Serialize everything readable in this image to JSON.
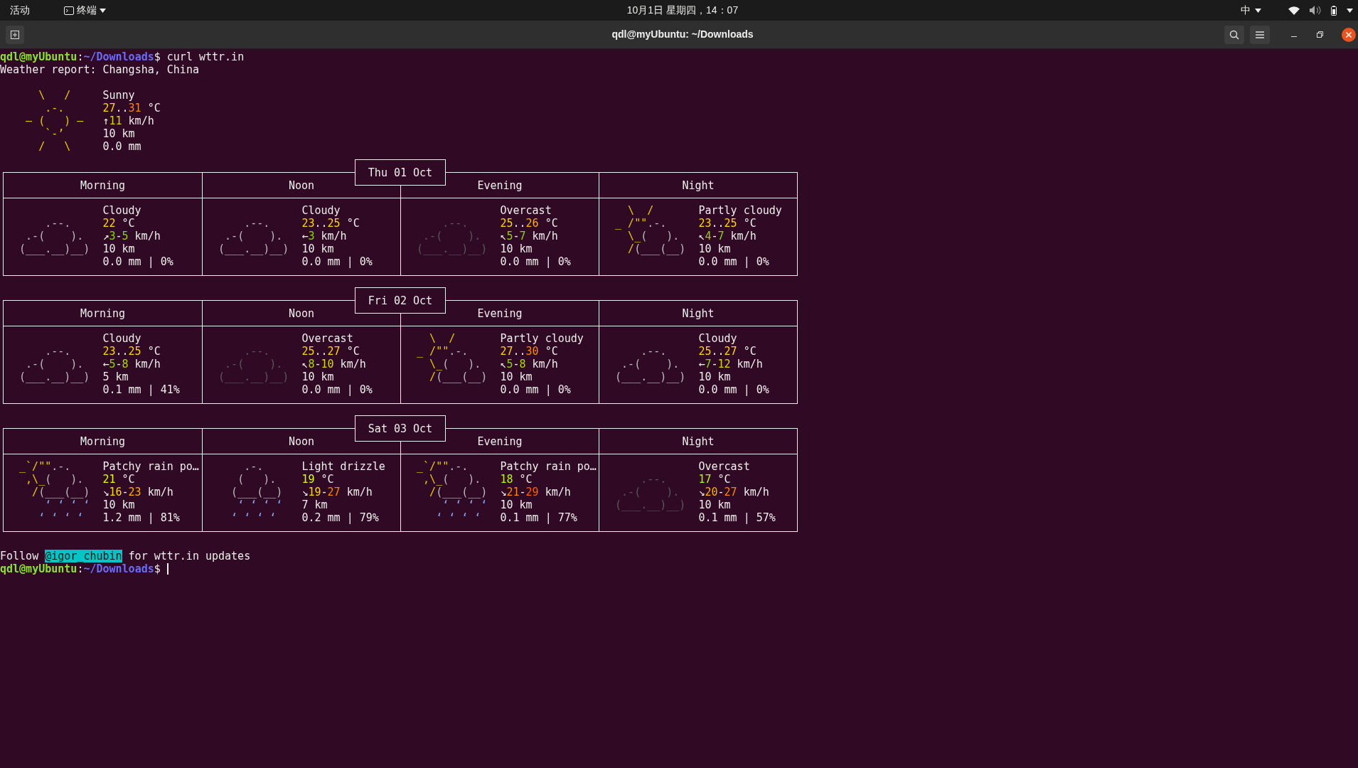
{
  "top_bar": {
    "activities": "活动",
    "app_menu": "终端",
    "clock": "10月1日 星期四，14：07",
    "input_method": "中"
  },
  "window": {
    "title": "qdl@myUbuntu: ~/Downloads"
  },
  "terminal": {
    "prompt": {
      "user_host": "qdl@myUbuntu",
      "separator": ":",
      "path": "~/Downloads",
      "symbol": "$",
      "command": " curl wttr.in"
    },
    "report_line": "Weather report: Changsha, China",
    "current": {
      "kind": "sunny",
      "art": [
        [
          {
            "text": "    \\   /",
            "color": "#e6c800"
          }
        ],
        [
          {
            "text": "     .-.",
            "color": "#e6c800"
          }
        ],
        [
          {
            "text": "  ― (   ) ―",
            "color": "#e6c800"
          }
        ],
        [
          {
            "text": "     `-’",
            "color": "#e6c800"
          }
        ],
        [
          {
            "text": "    /   \\",
            "color": "#e6c800"
          }
        ]
      ],
      "lines": [
        [
          {
            "text": "Sunny"
          }
        ],
        [
          {
            "text": "27",
            "color": "#ffd700"
          },
          {
            "text": ".."
          },
          {
            "text": "31",
            "color": "#ff8700"
          },
          {
            "text": " °C"
          }
        ],
        [
          {
            "text": "↑"
          },
          {
            "text": "11",
            "color": "#d7d700"
          },
          {
            "text": " km/h"
          }
        ],
        [
          {
            "text": "10 km"
          }
        ],
        [
          {
            "text": "0.0 mm"
          }
        ]
      ]
    },
    "days": [
      {
        "date": "Thu 01 Oct",
        "periods": [
          {
            "label": "Morning",
            "kind": "cloudy",
            "art": [
              [
                {
                  "text": "     .--.",
                  "color": "#bcbcbc"
                }
              ],
              [
                {
                  "text": "  .-(    ).",
                  "color": "#bcbcbc"
                }
              ],
              [
                {
                  "text": " (___.__)__)",
                  "color": "#bcbcbc"
                }
              ]
            ],
            "lines": [
              [
                {
                  "text": "Cloudy"
                }
              ],
              [
                {
                  "text": "22",
                  "color": "#ffd700"
                },
                {
                  "text": " °C"
                }
              ],
              [
                {
                  "text": "↗"
                },
                {
                  "text": "3",
                  "color": "#87d700"
                },
                {
                  "text": "-"
                },
                {
                  "text": "5",
                  "color": "#87d700"
                },
                {
                  "text": " km/h"
                }
              ],
              [
                {
                  "text": "10 km"
                }
              ],
              [
                {
                  "text": "0.0 mm | 0%"
                }
              ]
            ]
          },
          {
            "label": "Noon",
            "kind": "cloudy",
            "art": [
              [
                {
                  "text": "     .--.",
                  "color": "#bcbcbc"
                }
              ],
              [
                {
                  "text": "  .-(    ).",
                  "color": "#bcbcbc"
                }
              ],
              [
                {
                  "text": " (___.__)__)",
                  "color": "#bcbcbc"
                }
              ]
            ],
            "lines": [
              [
                {
                  "text": "Cloudy"
                }
              ],
              [
                {
                  "text": "23",
                  "color": "#ffd700"
                },
                {
                  "text": ".."
                },
                {
                  "text": "25",
                  "color": "#ffd700"
                },
                {
                  "text": " °C"
                }
              ],
              [
                {
                  "text": "←"
                },
                {
                  "text": "3",
                  "color": "#87d700"
                },
                {
                  "text": " km/h"
                }
              ],
              [
                {
                  "text": "10 km"
                }
              ],
              [
                {
                  "text": "0.0 mm | 0%"
                }
              ]
            ]
          },
          {
            "label": "Evening",
            "kind": "overcast",
            "art": [
              [
                {
                  "text": "     .--.",
                  "color": "#585858"
                }
              ],
              [
                {
                  "text": "  .-(    ).",
                  "color": "#585858"
                }
              ],
              [
                {
                  "text": " (___.__)__)",
                  "color": "#585858"
                }
              ]
            ],
            "lines": [
              [
                {
                  "text": "Overcast"
                }
              ],
              [
                {
                  "text": "25",
                  "color": "#ffd700"
                },
                {
                  "text": ".."
                },
                {
                  "text": "26",
                  "color": "#ffaf00"
                },
                {
                  "text": " °C"
                }
              ],
              [
                {
                  "text": "↖"
                },
                {
                  "text": "5",
                  "color": "#87d700"
                },
                {
                  "text": "-"
                },
                {
                  "text": "7",
                  "color": "#87d700"
                },
                {
                  "text": " km/h"
                }
              ],
              [
                {
                  "text": "10 km"
                }
              ],
              [
                {
                  "text": "0.0 mm | 0%"
                }
              ]
            ]
          },
          {
            "label": "Night",
            "kind": "partly_cloudy",
            "art": [
              [
                {
                  "text": "   \\  /",
                  "color": "#e6c800"
                }
              ],
              [
                {
                  "text": " _ /\"\"",
                  "color": "#e6c800"
                },
                {
                  "text": ".-.",
                  "color": "#bcbcbc"
                }
              ],
              [
                {
                  "text": "   \\_",
                  "color": "#e6c800"
                },
                {
                  "text": "(   ).",
                  "color": "#bcbcbc"
                }
              ],
              [
                {
                  "text": "   /",
                  "color": "#e6c800"
                },
                {
                  "text": "(___(__)",
                  "color": "#bcbcbc"
                }
              ]
            ],
            "lines": [
              [
                {
                  "text": "Partly cloudy"
                }
              ],
              [
                {
                  "text": "23",
                  "color": "#ffd700"
                },
                {
                  "text": ".."
                },
                {
                  "text": "25",
                  "color": "#ffd700"
                },
                {
                  "text": " °C"
                }
              ],
              [
                {
                  "text": "↖"
                },
                {
                  "text": "4",
                  "color": "#87d700"
                },
                {
                  "text": "-"
                },
                {
                  "text": "7",
                  "color": "#87d700"
                },
                {
                  "text": " km/h"
                }
              ],
              [
                {
                  "text": "10 km"
                }
              ],
              [
                {
                  "text": "0.0 mm | 0%"
                }
              ]
            ]
          }
        ]
      },
      {
        "date": "Fri 02 Oct",
        "periods": [
          {
            "label": "Morning",
            "kind": "cloudy",
            "art": [
              [
                {
                  "text": "     .--.",
                  "color": "#bcbcbc"
                }
              ],
              [
                {
                  "text": "  .-(    ).",
                  "color": "#bcbcbc"
                }
              ],
              [
                {
                  "text": " (___.__)__)",
                  "color": "#bcbcbc"
                }
              ]
            ],
            "lines": [
              [
                {
                  "text": "Cloudy"
                }
              ],
              [
                {
                  "text": "23",
                  "color": "#ffd700"
                },
                {
                  "text": ".."
                },
                {
                  "text": "25",
                  "color": "#ffd700"
                },
                {
                  "text": " °C"
                }
              ],
              [
                {
                  "text": "←"
                },
                {
                  "text": "5",
                  "color": "#87d700"
                },
                {
                  "text": "-"
                },
                {
                  "text": "8",
                  "color": "#afd700"
                },
                {
                  "text": " km/h"
                }
              ],
              [
                {
                  "text": "5 km"
                }
              ],
              [
                {
                  "text": "0.1 mm | 41%"
                }
              ]
            ]
          },
          {
            "label": "Noon",
            "kind": "overcast",
            "art": [
              [
                {
                  "text": "     .--.",
                  "color": "#585858"
                }
              ],
              [
                {
                  "text": "  .-(    ).",
                  "color": "#585858"
                }
              ],
              [
                {
                  "text": " (___.__)__)",
                  "color": "#585858"
                }
              ]
            ],
            "lines": [
              [
                {
                  "text": "Overcast"
                }
              ],
              [
                {
                  "text": "25",
                  "color": "#ffd700"
                },
                {
                  "text": ".."
                },
                {
                  "text": "27",
                  "color": "#ffd700"
                },
                {
                  "text": " °C"
                }
              ],
              [
                {
                  "text": "↖"
                },
                {
                  "text": "8",
                  "color": "#afd700"
                },
                {
                  "text": "-"
                },
                {
                  "text": "10",
                  "color": "#d7d700"
                },
                {
                  "text": " km/h"
                }
              ],
              [
                {
                  "text": "10 km"
                }
              ],
              [
                {
                  "text": "0.0 mm | 0%"
                }
              ]
            ]
          },
          {
            "label": "Evening",
            "kind": "partly_cloudy",
            "art": [
              [
                {
                  "text": "   \\  /",
                  "color": "#e6c800"
                }
              ],
              [
                {
                  "text": " _ /\"\"",
                  "color": "#e6c800"
                },
                {
                  "text": ".-.",
                  "color": "#bcbcbc"
                }
              ],
              [
                {
                  "text": "   \\_",
                  "color": "#e6c800"
                },
                {
                  "text": "(   ).",
                  "color": "#bcbcbc"
                }
              ],
              [
                {
                  "text": "   /",
                  "color": "#e6c800"
                },
                {
                  "text": "(___(__)",
                  "color": "#bcbcbc"
                }
              ]
            ],
            "lines": [
              [
                {
                  "text": "Partly cloudy"
                }
              ],
              [
                {
                  "text": "27",
                  "color": "#ffd700"
                },
                {
                  "text": ".."
                },
                {
                  "text": "30",
                  "color": "#ff8700"
                },
                {
                  "text": " °C"
                }
              ],
              [
                {
                  "text": "↖"
                },
                {
                  "text": "5",
                  "color": "#87d700"
                },
                {
                  "text": "-"
                },
                {
                  "text": "8",
                  "color": "#afd700"
                },
                {
                  "text": " km/h"
                }
              ],
              [
                {
                  "text": "10 km"
                }
              ],
              [
                {
                  "text": "0.0 mm | 0%"
                }
              ]
            ]
          },
          {
            "label": "Night",
            "kind": "cloudy",
            "art": [
              [
                {
                  "text": "     .--.",
                  "color": "#bcbcbc"
                }
              ],
              [
                {
                  "text": "  .-(    ).",
                  "color": "#bcbcbc"
                }
              ],
              [
                {
                  "text": " (___.__)__)",
                  "color": "#bcbcbc"
                }
              ]
            ],
            "lines": [
              [
                {
                  "text": "Cloudy"
                }
              ],
              [
                {
                  "text": "25",
                  "color": "#ffd700"
                },
                {
                  "text": ".."
                },
                {
                  "text": "27",
                  "color": "#ffd700"
                },
                {
                  "text": " °C"
                }
              ],
              [
                {
                  "text": "←"
                },
                {
                  "text": "7",
                  "color": "#87d700"
                },
                {
                  "text": "-"
                },
                {
                  "text": "12",
                  "color": "#d7d700"
                },
                {
                  "text": " km/h"
                }
              ],
              [
                {
                  "text": "10 km"
                }
              ],
              [
                {
                  "text": "0.0 mm | 0%"
                }
              ]
            ]
          }
        ]
      },
      {
        "date": "Sat 03 Oct",
        "periods": [
          {
            "label": "Morning",
            "kind": "rain",
            "art": [
              [
                {
                  "text": " _`/\"\"",
                  "color": "#e6c800"
                },
                {
                  "text": ".-.",
                  "color": "#bcbcbc"
                }
              ],
              [
                {
                  "text": "  ,\\_",
                  "color": "#e6c800"
                },
                {
                  "text": "(   ).",
                  "color": "#bcbcbc"
                }
              ],
              [
                {
                  "text": "   /",
                  "color": "#e6c800"
                },
                {
                  "text": "(___(__)",
                  "color": "#bcbcbc"
                }
              ],
              [
                {
                  "text": "     ‘ ‘ ‘ ‘",
                  "color": "#87afff"
                }
              ],
              [
                {
                  "text": "    ‘ ‘ ‘ ‘",
                  "color": "#87afff"
                }
              ]
            ],
            "lines": [
              [
                {
                  "text": "Patchy rain po…"
                }
              ],
              [
                {
                  "text": "21",
                  "color": "#d7ff00"
                },
                {
                  "text": " °C"
                }
              ],
              [
                {
                  "text": "↘"
                },
                {
                  "text": "16",
                  "color": "#ffd700"
                },
                {
                  "text": "-"
                },
                {
                  "text": "23",
                  "color": "#ffaf00"
                },
                {
                  "text": " km/h"
                }
              ],
              [
                {
                  "text": "10 km"
                }
              ],
              [
                {
                  "text": "1.2 mm | 81%"
                }
              ]
            ]
          },
          {
            "label": "Noon",
            "kind": "drizzle",
            "art": [
              [
                {
                  "text": "     .-.",
                  "color": "#bcbcbc"
                }
              ],
              [
                {
                  "text": "    (   ).",
                  "color": "#bcbcbc"
                }
              ],
              [
                {
                  "text": "   (___(__)",
                  "color": "#bcbcbc"
                }
              ],
              [
                {
                  "text": "    ‘ ‘ ‘ ‘",
                  "color": "#87afff"
                }
              ],
              [
                {
                  "text": "   ‘ ‘ ‘ ‘",
                  "color": "#87afff"
                }
              ]
            ],
            "lines": [
              [
                {
                  "text": "Light drizzle"
                }
              ],
              [
                {
                  "text": "19",
                  "color": "#d7ff00"
                },
                {
                  "text": " °C"
                }
              ],
              [
                {
                  "text": "↘"
                },
                {
                  "text": "19",
                  "color": "#ffd700"
                },
                {
                  "text": "-"
                },
                {
                  "text": "27",
                  "color": "#ff8700"
                },
                {
                  "text": " km/h"
                }
              ],
              [
                {
                  "text": "7 km"
                }
              ],
              [
                {
                  "text": "0.2 mm | 79%"
                }
              ]
            ]
          },
          {
            "label": "Evening",
            "kind": "rain",
            "art": [
              [
                {
                  "text": " _`/\"\"",
                  "color": "#e6c800"
                },
                {
                  "text": ".-.",
                  "color": "#bcbcbc"
                }
              ],
              [
                {
                  "text": "  ,\\_",
                  "color": "#e6c800"
                },
                {
                  "text": "(   ).",
                  "color": "#bcbcbc"
                }
              ],
              [
                {
                  "text": "   /",
                  "color": "#e6c800"
                },
                {
                  "text": "(___(__)",
                  "color": "#bcbcbc"
                }
              ],
              [
                {
                  "text": "     ‘ ‘ ‘ ‘",
                  "color": "#87afff"
                }
              ],
              [
                {
                  "text": "    ‘ ‘ ‘ ‘",
                  "color": "#87afff"
                }
              ]
            ],
            "lines": [
              [
                {
                  "text": "Patchy rain po…"
                }
              ],
              [
                {
                  "text": "18",
                  "color": "#afff00"
                },
                {
                  "text": " °C"
                }
              ],
              [
                {
                  "text": "↘"
                },
                {
                  "text": "21",
                  "color": "#ff8700"
                },
                {
                  "text": "-"
                },
                {
                  "text": "29",
                  "color": "#ff5f00"
                },
                {
                  "text": " km/h"
                }
              ],
              [
                {
                  "text": "10 km"
                }
              ],
              [
                {
                  "text": "0.1 mm | 77%"
                }
              ]
            ]
          },
          {
            "label": "Night",
            "kind": "overcast",
            "art": [
              [
                {
                  "text": "     .--.",
                  "color": "#585858"
                }
              ],
              [
                {
                  "text": "  .-(    ).",
                  "color": "#585858"
                }
              ],
              [
                {
                  "text": " (___.__)__)",
                  "color": "#585858"
                }
              ]
            ],
            "lines": [
              [
                {
                  "text": "Overcast"
                }
              ],
              [
                {
                  "text": "17",
                  "color": "#afff00"
                },
                {
                  "text": " °C"
                }
              ],
              [
                {
                  "text": "↘"
                },
                {
                  "text": "20",
                  "color": "#ffaf00"
                },
                {
                  "text": "-"
                },
                {
                  "text": "27",
                  "color": "#ff8700"
                },
                {
                  "text": " km/h"
                }
              ],
              [
                {
                  "text": "10 km"
                }
              ],
              [
                {
                  "text": "0.1 mm | 57%"
                }
              ]
            ]
          }
        ]
      }
    ],
    "follow": [
      {
        "text": "Follow",
        "highlight": false
      },
      {
        "text": "@igor_chubin",
        "highlight": true
      },
      {
        "text": "for wttr.in updates",
        "highlight": false
      }
    ],
    "final_prompt": {
      "user_host": "qdl@myUbuntu",
      "separator": ":",
      "path": "~/Downloads",
      "symbol": "$"
    }
  }
}
